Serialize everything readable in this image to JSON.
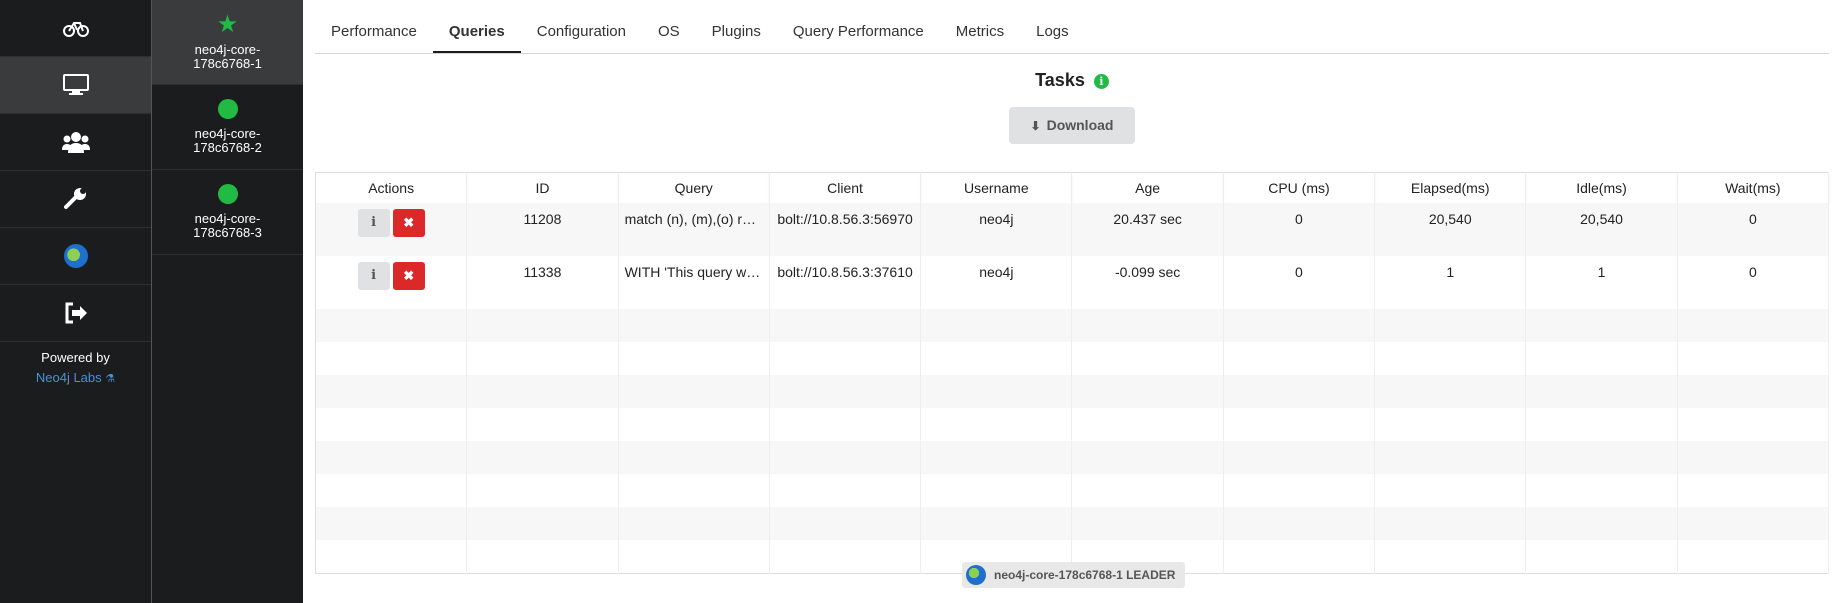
{
  "sidebar": {
    "icons": [
      "bicycle-icon",
      "desktop-icon",
      "users-icon",
      "wrench-icon",
      "globe-icon",
      "sign-out-icon"
    ],
    "powered_by": "Powered by",
    "labs_link": "Neo4j Labs"
  },
  "nodes": [
    {
      "line1": "neo4j-core-",
      "line2": "178c6768-1",
      "status": "leader"
    },
    {
      "line1": "neo4j-core-",
      "line2": "178c6768-2",
      "status": "online"
    },
    {
      "line1": "neo4j-core-",
      "line2": "178c6768-3",
      "status": "online"
    }
  ],
  "tabs": [
    "Performance",
    "Queries",
    "Configuration",
    "OS",
    "Plugins",
    "Query Performance",
    "Metrics",
    "Logs"
  ],
  "active_tab": "Queries",
  "tasks": {
    "title": "Tasks",
    "download_label": "Download"
  },
  "table": {
    "columns": [
      "Actions",
      "ID",
      "Query",
      "Client",
      "Username",
      "Age",
      "CPU (ms)",
      "Elapsed(ms)",
      "Idle(ms)",
      "Wait(ms)"
    ],
    "rows": [
      {
        "id": "11208",
        "query": "match (n), (m),(o) return count(n)",
        "client": "bolt://10.8.56.3:56970",
        "username": "neo4j",
        "age": "20.437 sec",
        "cpu": "0",
        "elapsed": "20,540",
        "idle": "20,540",
        "wait": "0"
      },
      {
        "id": "11338",
        "query": "WITH 'This query was executed'",
        "client": "bolt://10.8.56.3:37610",
        "username": "neo4j",
        "age": "-0.099 sec",
        "cpu": "0",
        "elapsed": "1",
        "idle": "1",
        "wait": "0"
      }
    ]
  },
  "footer": {
    "label": "neo4j-core-178c6768-1 LEADER"
  },
  "colors": {
    "green": "#21ba45",
    "red": "#db2828",
    "sidebar": "#1b1c1d"
  }
}
